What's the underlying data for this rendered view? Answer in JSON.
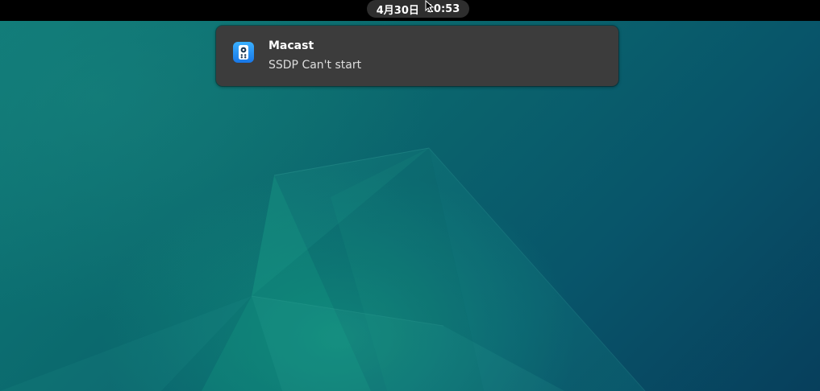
{
  "topbar": {
    "date": "4月30日",
    "time": "10:53"
  },
  "notification": {
    "app_icon": "speaker-icon",
    "title": "Macast",
    "body": "SSDP Can't start"
  },
  "colors": {
    "topbar": "#000000",
    "clock_pill": "#2e2e2e",
    "notification_bg": "#3c3c3c",
    "app_icon_accent": "#1877e8",
    "wallpaper_teal": "#0f7a78",
    "wallpaper_deep": "#073f5c"
  }
}
